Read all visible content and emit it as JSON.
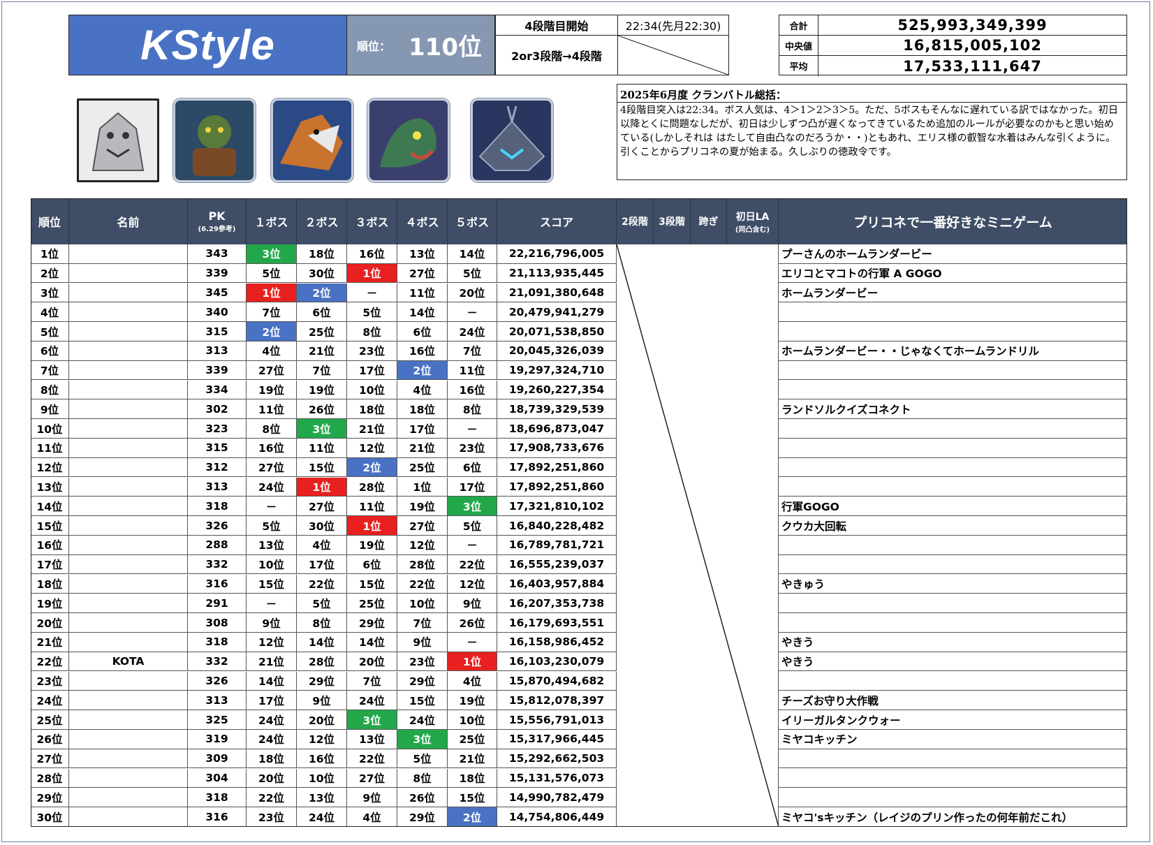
{
  "header": {
    "brand": "KStyle",
    "rank_label": "順位：",
    "rank_value": "110位",
    "stage4_label": "4段階目開始",
    "stage4_time": "22:34(先月22:30)",
    "stage_transition": "2or3段階→4段階"
  },
  "stats": [
    {
      "label": "合計",
      "value": "525,993,349,399"
    },
    {
      "label": "中央値",
      "value": "16,815,005,102"
    },
    {
      "label": "平均",
      "value": "17,533,111,647"
    }
  ],
  "summary": {
    "title": "2025年6月度 クランバトル総括：",
    "body": "4段階目突入は22:34。ボス人気は、4＞1＞2＞3＞5。ただ、5ボスもそんなに遅れている訳ではなかった。初日以降とくに問題なしだが、初日は少しずつ凸が遅くなってきているため追加のルールが必要なのかもと思い始めている(しかしそれは はたして自由凸なのだろうか・・)ともあれ、エリス様の叡智な水着はみんな引くように。引くことからプリコネの夏が始まる。久しぶりの徳政令です。"
  },
  "bosses": [
    {
      "name": "boss-1-golem",
      "color": "#b9b9bd"
    },
    {
      "name": "boss-2-goblin",
      "color": "#5a7a3a"
    },
    {
      "name": "boss-3-griffon",
      "color": "#c8742e"
    },
    {
      "name": "boss-4-dragon",
      "color": "#3d7a52"
    },
    {
      "name": "boss-5-machine",
      "color": "#56627a"
    }
  ],
  "columns": {
    "rank": "順位",
    "name": "名前",
    "pk": "PK",
    "pk_sub": "(6.29参考)",
    "b1": "１ボス",
    "b2": "２ボス",
    "b3": "３ボス",
    "b4": "４ボス",
    "b5": "５ボス",
    "score": "スコア",
    "s2": "2段階",
    "s3": "3段階",
    "cross": "跨ぎ",
    "la": "初日LA",
    "la_sub": "(同凸含む)",
    "game": "プリコネで一番好きなミニゲーム"
  },
  "rows": [
    {
      "rank": "1位",
      "name": "",
      "pk": "343",
      "b": [
        "3位",
        "18位",
        "16位",
        "13位",
        "14位"
      ],
      "hl": [
        "gold",
        "",
        "",
        "",
        ""
      ],
      "score": "22,216,796,005",
      "game": "プーさんのホームランダービー"
    },
    {
      "rank": "2位",
      "name": "",
      "pk": "339",
      "b": [
        "5位",
        "30位",
        "1位",
        "27位",
        "5位"
      ],
      "hl": [
        "",
        "",
        "red",
        "",
        ""
      ],
      "score": "21,113,935,445",
      "game": "エリコとマコトの行軍 A GOGO"
    },
    {
      "rank": "3位",
      "name": "",
      "pk": "345",
      "b": [
        "1位",
        "2位",
        "－",
        "11位",
        "20位"
      ],
      "hl": [
        "red",
        "blue",
        "",
        "",
        ""
      ],
      "score": "21,091,380,648",
      "game": "ホームランダービー"
    },
    {
      "rank": "4位",
      "name": "",
      "pk": "340",
      "b": [
        "7位",
        "6位",
        "5位",
        "14位",
        "－"
      ],
      "hl": [
        "",
        "",
        "",
        "",
        ""
      ],
      "score": "20,479,941,279",
      "game": ""
    },
    {
      "rank": "5位",
      "name": "",
      "pk": "315",
      "b": [
        "2位",
        "25位",
        "8位",
        "6位",
        "24位"
      ],
      "hl": [
        "blue",
        "",
        "",
        "",
        ""
      ],
      "score": "20,071,538,850",
      "game": ""
    },
    {
      "rank": "6位",
      "name": "",
      "pk": "313",
      "b": [
        "4位",
        "21位",
        "23位",
        "16位",
        "7位"
      ],
      "hl": [
        "",
        "",
        "",
        "",
        ""
      ],
      "score": "20,045,326,039",
      "game": "ホームランダービー・・じゃなくてホームランドリル"
    },
    {
      "rank": "7位",
      "name": "",
      "pk": "339",
      "b": [
        "27位",
        "7位",
        "17位",
        "2位",
        "11位"
      ],
      "hl": [
        "",
        "",
        "",
        "blue",
        ""
      ],
      "score": "19,297,324,710",
      "game": ""
    },
    {
      "rank": "8位",
      "name": "",
      "pk": "334",
      "b": [
        "19位",
        "19位",
        "10位",
        "4位",
        "16位"
      ],
      "hl": [
        "",
        "",
        "",
        "",
        ""
      ],
      "score": "19,260,227,354",
      "game": ""
    },
    {
      "rank": "9位",
      "name": "",
      "pk": "302",
      "b": [
        "11位",
        "26位",
        "18位",
        "18位",
        "8位"
      ],
      "hl": [
        "",
        "",
        "",
        "",
        ""
      ],
      "score": "18,739,329,539",
      "game": "ランドソルクイズコネクト"
    },
    {
      "rank": "10位",
      "name": "",
      "pk": "323",
      "b": [
        "8位",
        "3位",
        "21位",
        "17位",
        "－"
      ],
      "hl": [
        "",
        "gold",
        "",
        "",
        ""
      ],
      "score": "18,696,873,047",
      "game": ""
    },
    {
      "rank": "11位",
      "name": "",
      "pk": "315",
      "b": [
        "16位",
        "11位",
        "12位",
        "21位",
        "23位"
      ],
      "hl": [
        "",
        "",
        "",
        "",
        ""
      ],
      "score": "17,908,733,676",
      "game": ""
    },
    {
      "rank": "12位",
      "name": "",
      "pk": "312",
      "b": [
        "27位",
        "15位",
        "2位",
        "25位",
        "6位"
      ],
      "hl": [
        "",
        "",
        "blue",
        "",
        ""
      ],
      "score": "17,892,251,860",
      "game": ""
    },
    {
      "rank": "13位",
      "name": "",
      "pk": "313",
      "b": [
        "24位",
        "1位",
        "28位",
        "1位",
        "17位"
      ],
      "hl": [
        "",
        "red",
        "",
        "",
        ""
      ],
      "score": "17,892,251,860",
      "game": ""
    },
    {
      "rank": "14位",
      "name": "",
      "pk": "318",
      "b": [
        "－",
        "27位",
        "11位",
        "19位",
        "3位"
      ],
      "hl": [
        "",
        "",
        "",
        "",
        "gold"
      ],
      "score": "17,321,810,102",
      "game": "行軍GOGO"
    },
    {
      "rank": "15位",
      "name": "",
      "pk": "326",
      "b": [
        "5位",
        "30位",
        "1位",
        "27位",
        "5位"
      ],
      "hl": [
        "",
        "",
        "red",
        "",
        ""
      ],
      "score": "16,840,228,482",
      "game": "クウカ大回転"
    },
    {
      "rank": "16位",
      "name": "",
      "pk": "288",
      "b": [
        "13位",
        "4位",
        "19位",
        "12位",
        "－"
      ],
      "hl": [
        "",
        "",
        "",
        "",
        ""
      ],
      "score": "16,789,781,721",
      "game": ""
    },
    {
      "rank": "17位",
      "name": "",
      "pk": "332",
      "b": [
        "10位",
        "17位",
        "6位",
        "28位",
        "22位"
      ],
      "hl": [
        "",
        "",
        "",
        "",
        ""
      ],
      "score": "16,555,239,037",
      "game": ""
    },
    {
      "rank": "18位",
      "name": "",
      "pk": "316",
      "b": [
        "15位",
        "22位",
        "15位",
        "22位",
        "12位"
      ],
      "hl": [
        "",
        "",
        "",
        "",
        ""
      ],
      "score": "16,403,957,884",
      "game": "やきゅう"
    },
    {
      "rank": "19位",
      "name": "",
      "pk": "291",
      "b": [
        "－",
        "5位",
        "25位",
        "10位",
        "9位"
      ],
      "hl": [
        "",
        "",
        "",
        "",
        ""
      ],
      "score": "16,207,353,738",
      "game": ""
    },
    {
      "rank": "20位",
      "name": "",
      "pk": "308",
      "b": [
        "9位",
        "8位",
        "29位",
        "7位",
        "26位"
      ],
      "hl": [
        "",
        "",
        "",
        "",
        ""
      ],
      "score": "16,179,693,551",
      "game": ""
    },
    {
      "rank": "21位",
      "name": "",
      "pk": "318",
      "b": [
        "12位",
        "14位",
        "14位",
        "9位",
        "－"
      ],
      "hl": [
        "",
        "",
        "",
        "",
        ""
      ],
      "score": "16,158,986,452",
      "game": "やきう"
    },
    {
      "rank": "22位",
      "name": "KOTA",
      "pk": "332",
      "b": [
        "21位",
        "28位",
        "20位",
        "23位",
        "1位"
      ],
      "hl": [
        "",
        "",
        "",
        "",
        "red"
      ],
      "score": "16,103,230,079",
      "game": "やきう"
    },
    {
      "rank": "23位",
      "name": "",
      "pk": "326",
      "b": [
        "14位",
        "29位",
        "7位",
        "29位",
        "4位"
      ],
      "hl": [
        "",
        "",
        "",
        "",
        ""
      ],
      "score": "15,870,494,682",
      "game": ""
    },
    {
      "rank": "24位",
      "name": "",
      "pk": "313",
      "b": [
        "17位",
        "9位",
        "24位",
        "15位",
        "19位"
      ],
      "hl": [
        "",
        "",
        "",
        "",
        ""
      ],
      "score": "15,812,078,397",
      "game": "チーズお守り大作戦"
    },
    {
      "rank": "25位",
      "name": "",
      "pk": "325",
      "b": [
        "24位",
        "20位",
        "3位",
        "24位",
        "10位"
      ],
      "hl": [
        "",
        "",
        "gold",
        "",
        ""
      ],
      "score": "15,556,791,013",
      "game": "イリーガルタンクウォー"
    },
    {
      "rank": "26位",
      "name": "",
      "pk": "319",
      "b": [
        "24位",
        "12位",
        "13位",
        "3位",
        "25位"
      ],
      "hl": [
        "",
        "",
        "",
        "gold",
        ""
      ],
      "score": "15,317,966,445",
      "game": "ミヤコキッチン"
    },
    {
      "rank": "27位",
      "name": "",
      "pk": "309",
      "b": [
        "18位",
        "16位",
        "22位",
        "5位",
        "21位"
      ],
      "hl": [
        "",
        "",
        "",
        "",
        ""
      ],
      "score": "15,292,662,503",
      "game": ""
    },
    {
      "rank": "28位",
      "name": "",
      "pk": "304",
      "b": [
        "20位",
        "10位",
        "27位",
        "8位",
        "18位"
      ],
      "hl": [
        "",
        "",
        "",
        "",
        ""
      ],
      "score": "15,131,576,073",
      "game": ""
    },
    {
      "rank": "29位",
      "name": "",
      "pk": "318",
      "b": [
        "22位",
        "13位",
        "9位",
        "26位",
        "15位"
      ],
      "hl": [
        "",
        "",
        "",
        "",
        ""
      ],
      "score": "14,990,782,479",
      "game": ""
    },
    {
      "rank": "30位",
      "name": "",
      "pk": "316",
      "b": [
        "23位",
        "24位",
        "4位",
        "29位",
        "2位"
      ],
      "hl": [
        "",
        "",
        "",
        "",
        "blue"
      ],
      "score": "14,754,806,449",
      "game": "ミヤコ'sキッチン（レイジのプリン作ったの何年前だこれ）"
    }
  ]
}
